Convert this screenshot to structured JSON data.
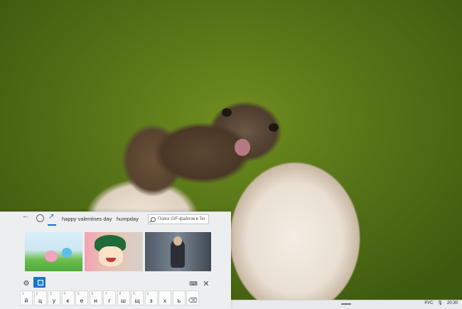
{
  "taskbar": {
    "lang": "РУС",
    "time": "20:30"
  },
  "gif_panel": {
    "chips": [
      "happy valentines day",
      "humpday"
    ],
    "search_placeholder": "Поиск GIF-файлов в Ter",
    "icons": {
      "back": "back-arrow-icon",
      "recent": "clock-icon",
      "trending": "trending-icon",
      "settings": "gear-icon",
      "gif": "gif-icon",
      "keyboard": "keyboard-icon",
      "close": "close-icon"
    },
    "accent": "#1a73c9"
  },
  "keyboard": {
    "row": [
      {
        "num": "1",
        "char": "й"
      },
      {
        "num": "2",
        "char": "ц"
      },
      {
        "num": "3",
        "char": "у"
      },
      {
        "num": "4",
        "char": "к"
      },
      {
        "num": "5",
        "char": "е"
      },
      {
        "num": "6",
        "char": "н"
      },
      {
        "num": "7",
        "char": "г"
      },
      {
        "num": "8",
        "char": "ш"
      },
      {
        "num": "9",
        "char": "щ"
      },
      {
        "num": "0",
        "char": "з"
      },
      {
        "num": "",
        "char": "х"
      },
      {
        "num": "",
        "char": "ъ"
      },
      {
        "num": "",
        "char": "⌫"
      }
    ]
  }
}
